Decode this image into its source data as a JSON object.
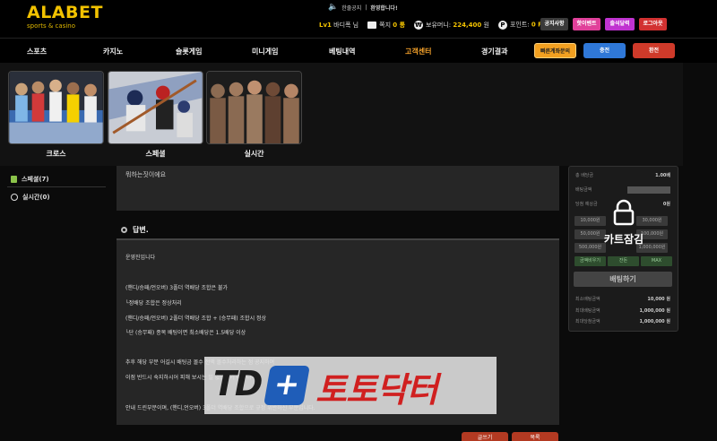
{
  "brand": {
    "name": "ALABET",
    "sub": "sports & casino"
  },
  "header": {
    "notice_label": "한줄공지",
    "notice_text": "환영합니다!",
    "level": "Lv1",
    "user": "바디폭 님",
    "message_label": "쪽지",
    "message_count": "0 통",
    "money_label": "보유머니:",
    "money_value": "224,400",
    "money_unit": "원",
    "points_label": "포인트:",
    "points_value": "0 P",
    "buttons": [
      "공지사항",
      "핫이벤트",
      "출석달력",
      "로그아웃"
    ]
  },
  "nav": {
    "items": [
      "스포츠",
      "카지노",
      "슬롯게임",
      "미니게임",
      "베팅내역",
      "고객센터",
      "경기결과"
    ],
    "active": "고객센터",
    "fast_inquiry": "빠른계좌문의",
    "charge": "충전",
    "exchange": "환전"
  },
  "dropdown": {
    "items": [
      {
        "label": "크로스"
      },
      {
        "label": "스페셜"
      },
      {
        "label": "실시간"
      }
    ]
  },
  "sidebar": {
    "items": [
      {
        "label": "스페셜(7)"
      },
      {
        "label": "실시간(0)"
      }
    ]
  },
  "question": {
    "text": "뭐하는짓이에요"
  },
  "answer": {
    "heading": "답변.",
    "lines": [
      "운영진입니다",
      "",
      "(핸디/승패/언오버) 3폴더 역배당 조합은 불가",
      "└정배당 조합은 정상처리",
      "(핸디/승패/언오버) 2폴더 역배당 조합 + (승무패) 조합시 정상",
      "└단 (승무패) 종목 배팅이면 최소배당은 1.5배당 이상",
      "",
      "추후 해당 부분 어길시 배팅금 몰수 전액 몰수처리하는 점 공지하며",
      "이점 반드시 숙지하시어 피해 보시는 일 없으시기 바랍니다",
      "",
      "안내 드린부분이며, (핸디,언오버) 3폴더 역배당 조합으로 규정 위반하신 부분입니다."
    ]
  },
  "bottom_buttons": [
    "글쓰기",
    "목록"
  ],
  "betslip": {
    "total_odds_label": "총 배당금",
    "total_odds": "1.00배",
    "bet_amount_label": "배팅금액",
    "expected_label": "당첨 예상금",
    "expected": "0원",
    "amounts": [
      "10,000원",
      "30,000원",
      "50,000원",
      "100,000원",
      "500,000원",
      "1,000,000원"
    ],
    "actions": [
      "금액비우기",
      "잔돈",
      "MAX"
    ],
    "bet_button": "배팅하기",
    "lock_text": "카트잠김",
    "limits": [
      {
        "label": "최소배팅금액",
        "value": "10,000 원"
      },
      {
        "label": "최대배팅금액",
        "value": "1,000,000 원"
      },
      {
        "label": "최대당첨금액",
        "value": "1,000,000 원"
      }
    ]
  },
  "watermark": {
    "latin": "TD",
    "plus": "+",
    "korean": "토토닥터"
  }
}
